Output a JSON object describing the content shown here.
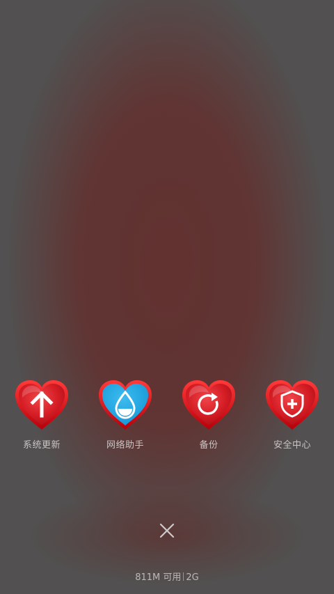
{
  "shortcuts": [
    {
      "label": "系统更新",
      "icon": "arrow-up-icon",
      "color": "#d4202a"
    },
    {
      "label": "网络助手",
      "icon": "water-drop-icon",
      "color": "#1aa3e0"
    },
    {
      "label": "备份",
      "icon": "refresh-icon",
      "color": "#d4202a"
    },
    {
      "label": "安全中心",
      "icon": "shield-plus-icon",
      "color": "#d4202a"
    }
  ],
  "status": {
    "memory": "811M 可用",
    "network": "2G"
  },
  "close_icon": "close-icon"
}
